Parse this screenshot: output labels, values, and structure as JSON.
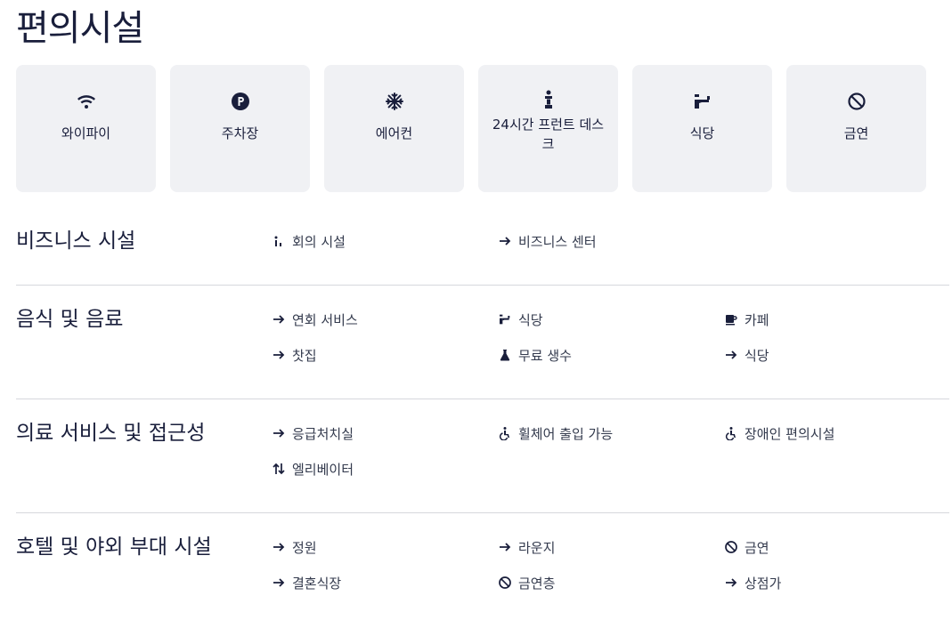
{
  "page_title": "편의시설",
  "cards": [
    {
      "label": "와이파이",
      "icon": "wifi-icon"
    },
    {
      "label": "주차장",
      "icon": "parking-icon"
    },
    {
      "label": "에어컨",
      "icon": "snowflake-icon"
    },
    {
      "label": "24시간 프런트 데스크",
      "icon": "front-desk-icon"
    },
    {
      "label": "식당",
      "icon": "restaurant-icon"
    },
    {
      "label": "금연",
      "icon": "no-smoking-icon"
    }
  ],
  "sections": [
    {
      "title": "비즈니스 시설",
      "items": [
        {
          "label": "회의 시설",
          "icon": "meeting-icon"
        },
        {
          "label": "비즈니스 센터",
          "icon": "arrow-icon"
        }
      ]
    },
    {
      "title": "음식 및 음료",
      "items": [
        {
          "label": "연회 서비스",
          "icon": "arrow-icon"
        },
        {
          "label": "식당",
          "icon": "restaurant-icon"
        },
        {
          "label": "카페",
          "icon": "coffee-icon"
        },
        {
          "label": "찻집",
          "icon": "arrow-icon"
        },
        {
          "label": "무료 생수",
          "icon": "flask-icon"
        },
        {
          "label": "식당",
          "icon": "arrow-icon"
        }
      ]
    },
    {
      "title": "의료 서비스 및 접근성",
      "items": [
        {
          "label": "응급처치실",
          "icon": "arrow-icon"
        },
        {
          "label": "휠체어 출입 가능",
          "icon": "wheelchair-icon"
        },
        {
          "label": "장애인 편의시설",
          "icon": "wheelchair-icon"
        },
        {
          "label": "엘리베이터",
          "icon": "elevator-icon"
        }
      ]
    },
    {
      "title": "호텔 및 야외 부대 시설",
      "items": [
        {
          "label": "정원",
          "icon": "arrow-icon"
        },
        {
          "label": "라운지",
          "icon": "arrow-icon"
        },
        {
          "label": "금연",
          "icon": "no-smoking-icon"
        },
        {
          "label": "결혼식장",
          "icon": "arrow-icon"
        },
        {
          "label": "금연층",
          "icon": "no-smoking-icon"
        },
        {
          "label": "상점가",
          "icon": "arrow-icon"
        }
      ]
    }
  ]
}
